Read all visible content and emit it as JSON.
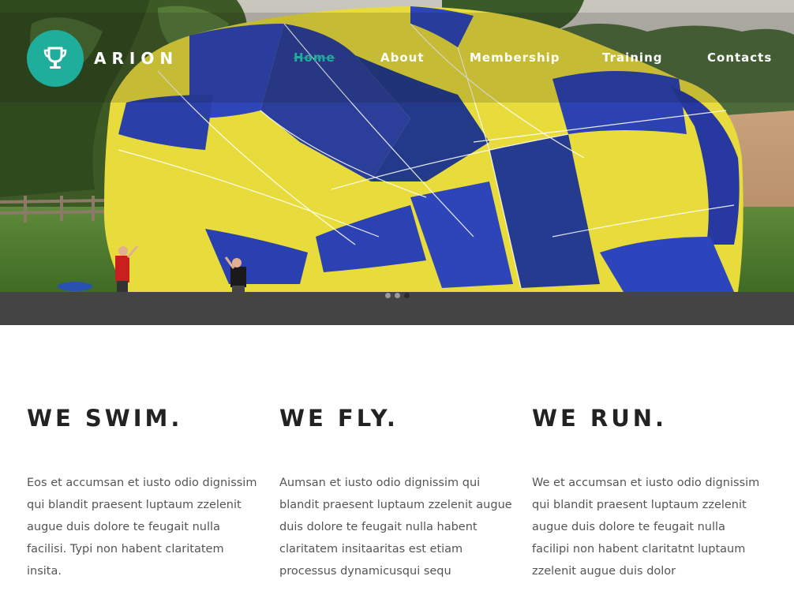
{
  "brand": {
    "name": "ARION",
    "logo_icon": "trophy-icon",
    "accent_color": "#1fae9b"
  },
  "nav": {
    "items": [
      {
        "label": "Home",
        "active": true
      },
      {
        "label": "About",
        "active": false
      },
      {
        "label": "Membership",
        "active": false
      },
      {
        "label": "Training",
        "active": false
      },
      {
        "label": "Contacts",
        "active": false
      }
    ]
  },
  "slider": {
    "image": "hot-air-balloon-inflation",
    "dot_count": 3,
    "active_dot": 3
  },
  "features": [
    {
      "title": "WE SWIM.",
      "text": "Eos et accumsan et iusto odio dignissim qui blandit praesent luptaum zzelenit augue duis dolore te feugait nulla facilisi. Typi non habent claritatem insita."
    },
    {
      "title": "WE FLY.",
      "text": "Aumsan et iusto odio dignissim qui blandit praesent luptaum zzelenit augue duis dolore te feugait nulla habent claritatem insitaaritas est etiam processus dynamicusqui sequ"
    },
    {
      "title": "WE RUN.",
      "text": "We et accumsan et iusto odio dignissim qui blandit praesent luptaum zzelenit augue duis dolore te feugait nulla facilipi non habent claritatnt luptaum zzelenit augue duis dolor"
    }
  ]
}
